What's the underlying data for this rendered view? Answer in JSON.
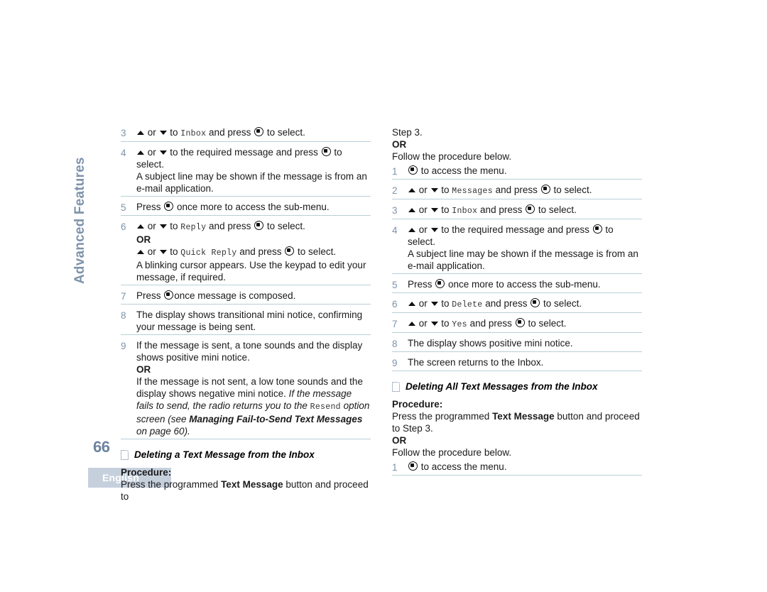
{
  "page": {
    "number": "66",
    "chapter_tab": "Advanced Features",
    "language_tab": "English",
    "accent_color": "#7d93ab",
    "rule_color": "#b9cfd8",
    "tab_bg_color": "#c6d0dd"
  },
  "icons": {
    "up": "up-arrow-icon",
    "down": "down-arrow-icon",
    "menu_button": "menu-select-button-icon",
    "section": "document-page-icon"
  },
  "left_column": {
    "steps": [
      {
        "num": "3",
        "lines": [
          {
            "parts": [
              {
                "t": "icon",
                "v": "up"
              },
              {
                "t": "text",
                "v": " or "
              },
              {
                "t": "icon",
                "v": "down"
              },
              {
                "t": "text",
                "v": " to "
              },
              {
                "t": "mono",
                "v": "Inbox"
              },
              {
                "t": "text",
                "v": " and press "
              },
              {
                "t": "icon",
                "v": "menu"
              },
              {
                "t": "text",
                "v": " to select."
              }
            ]
          }
        ]
      },
      {
        "num": "4",
        "lines": [
          {
            "parts": [
              {
                "t": "icon",
                "v": "up"
              },
              {
                "t": "text",
                "v": " or "
              },
              {
                "t": "icon",
                "v": "down"
              },
              {
                "t": "text",
                "v": " to the required message and press "
              },
              {
                "t": "icon",
                "v": "menu"
              },
              {
                "t": "text",
                "v": " to select."
              }
            ]
          },
          {
            "parts": [
              {
                "t": "text",
                "v": "A subject line may be shown if the message is from an e-mail application."
              }
            ]
          }
        ]
      },
      {
        "num": "5",
        "lines": [
          {
            "parts": [
              {
                "t": "text",
                "v": "Press "
              },
              {
                "t": "icon",
                "v": "menu"
              },
              {
                "t": "text",
                "v": " once more to access the sub-menu."
              }
            ]
          }
        ]
      },
      {
        "num": "6",
        "lines": [
          {
            "parts": [
              {
                "t": "icon",
                "v": "up"
              },
              {
                "t": "text",
                "v": " or "
              },
              {
                "t": "icon",
                "v": "down"
              },
              {
                "t": "text",
                "v": " to "
              },
              {
                "t": "mono",
                "v": "Reply"
              },
              {
                "t": "text",
                "v": " and press "
              },
              {
                "t": "icon",
                "v": "menu"
              },
              {
                "t": "text",
                "v": " to select."
              }
            ]
          },
          {
            "parts": [
              {
                "t": "bold",
                "v": "OR"
              }
            ]
          },
          {
            "parts": [
              {
                "t": "icon",
                "v": "up"
              },
              {
                "t": "text",
                "v": " or "
              },
              {
                "t": "icon",
                "v": "down"
              },
              {
                "t": "text",
                "v": " to "
              },
              {
                "t": "mono",
                "v": "Quick Reply"
              },
              {
                "t": "text",
                "v": " and press "
              },
              {
                "t": "icon",
                "v": "menu"
              },
              {
                "t": "text",
                "v": " to select."
              }
            ]
          },
          {
            "parts": [
              {
                "t": "text",
                "v": "A blinking cursor appears. Use the keypad to edit your message, if required."
              }
            ]
          }
        ]
      },
      {
        "num": "7",
        "lines": [
          {
            "parts": [
              {
                "t": "text",
                "v": "Press "
              },
              {
                "t": "icon",
                "v": "menu"
              },
              {
                "t": "text",
                "v": "once message is composed."
              }
            ]
          }
        ]
      },
      {
        "num": "8",
        "lines": [
          {
            "parts": [
              {
                "t": "text",
                "v": "The display shows transitional mini notice, confirming your message is being sent."
              }
            ]
          }
        ]
      },
      {
        "num": "9",
        "lines": [
          {
            "parts": [
              {
                "t": "text",
                "v": "If the message is sent, a tone sounds and the display shows positive mini notice."
              }
            ]
          },
          {
            "parts": [
              {
                "t": "bold",
                "v": "OR"
              }
            ]
          },
          {
            "parts": [
              {
                "t": "text",
                "v": "If the message is not sent, a low tone sounds and the display shows negative mini notice. "
              },
              {
                "t": "ital",
                "v": "If the message fails to send, the radio returns you to the "
              },
              {
                "t": "mono",
                "v": "Resend"
              },
              {
                "t": "ital",
                "v": " option screen (see "
              },
              {
                "t": "bi",
                "v": "Managing Fail-to-Send Text Messages"
              },
              {
                "t": "ital",
                "v": " on page 60)."
              }
            ]
          }
        ]
      }
    ],
    "section": {
      "title": "Deleting a Text Message from the Inbox",
      "procedure_label": "Procedure:",
      "intro": [
        {
          "parts": [
            {
              "t": "text",
              "v": "Press the programmed "
            },
            {
              "t": "bold",
              "v": "Text Message"
            },
            {
              "t": "text",
              "v": " button and proceed to"
            }
          ]
        }
      ]
    }
  },
  "right_column": {
    "intro": [
      {
        "parts": [
          {
            "t": "text",
            "v": "Step 3."
          }
        ]
      },
      {
        "parts": [
          {
            "t": "bold",
            "v": "OR"
          }
        ]
      },
      {
        "parts": [
          {
            "t": "text",
            "v": "Follow the procedure below."
          }
        ]
      }
    ],
    "steps": [
      {
        "num": "1",
        "lines": [
          {
            "parts": [
              {
                "t": "icon",
                "v": "menu"
              },
              {
                "t": "text",
                "v": " to access the menu."
              }
            ]
          }
        ]
      },
      {
        "num": "2",
        "lines": [
          {
            "parts": [
              {
                "t": "icon",
                "v": "up"
              },
              {
                "t": "text",
                "v": " or "
              },
              {
                "t": "icon",
                "v": "down"
              },
              {
                "t": "text",
                "v": " to "
              },
              {
                "t": "mono",
                "v": "Messages"
              },
              {
                "t": "text",
                "v": " and press "
              },
              {
                "t": "icon",
                "v": "menu"
              },
              {
                "t": "text",
                "v": " to select."
              }
            ]
          }
        ]
      },
      {
        "num": "3",
        "lines": [
          {
            "parts": [
              {
                "t": "icon",
                "v": "up"
              },
              {
                "t": "text",
                "v": " or "
              },
              {
                "t": "icon",
                "v": "down"
              },
              {
                "t": "text",
                "v": " to "
              },
              {
                "t": "mono",
                "v": "Inbox"
              },
              {
                "t": "text",
                "v": " and press "
              },
              {
                "t": "icon",
                "v": "menu"
              },
              {
                "t": "text",
                "v": " to select."
              }
            ]
          }
        ]
      },
      {
        "num": "4",
        "lines": [
          {
            "parts": [
              {
                "t": "icon",
                "v": "up"
              },
              {
                "t": "text",
                "v": " or "
              },
              {
                "t": "icon",
                "v": "down"
              },
              {
                "t": "text",
                "v": " to the required message and press "
              },
              {
                "t": "icon",
                "v": "menu"
              },
              {
                "t": "text",
                "v": " to select."
              }
            ]
          },
          {
            "parts": [
              {
                "t": "text",
                "v": "A subject line may be shown if the message is from an e-mail application."
              }
            ]
          }
        ]
      },
      {
        "num": "5",
        "lines": [
          {
            "parts": [
              {
                "t": "text",
                "v": "Press "
              },
              {
                "t": "icon",
                "v": "menu"
              },
              {
                "t": "text",
                "v": " once more to access the sub-menu."
              }
            ]
          }
        ]
      },
      {
        "num": "6",
        "lines": [
          {
            "parts": [
              {
                "t": "icon",
                "v": "up"
              },
              {
                "t": "text",
                "v": " or "
              },
              {
                "t": "icon",
                "v": "down"
              },
              {
                "t": "text",
                "v": " to "
              },
              {
                "t": "mono",
                "v": "Delete"
              },
              {
                "t": "text",
                "v": " and press "
              },
              {
                "t": "icon",
                "v": "menu"
              },
              {
                "t": "text",
                "v": " to select."
              }
            ]
          }
        ]
      },
      {
        "num": "7",
        "lines": [
          {
            "parts": [
              {
                "t": "icon",
                "v": "up"
              },
              {
                "t": "text",
                "v": " or "
              },
              {
                "t": "icon",
                "v": "down"
              },
              {
                "t": "text",
                "v": " to "
              },
              {
                "t": "mono",
                "v": "Yes"
              },
              {
                "t": "text",
                "v": " and press "
              },
              {
                "t": "icon",
                "v": "menu"
              },
              {
                "t": "text",
                "v": " to select."
              }
            ]
          }
        ]
      },
      {
        "num": "8",
        "lines": [
          {
            "parts": [
              {
                "t": "text",
                "v": "The display shows positive mini notice."
              }
            ]
          }
        ]
      },
      {
        "num": "9",
        "lines": [
          {
            "parts": [
              {
                "t": "text",
                "v": "The screen returns to the Inbox."
              }
            ]
          }
        ]
      }
    ],
    "section": {
      "title": "Deleting All Text Messages from the Inbox",
      "procedure_label": "Procedure:",
      "intro": [
        {
          "parts": [
            {
              "t": "text",
              "v": "Press the programmed "
            },
            {
              "t": "bold",
              "v": "Text Message"
            },
            {
              "t": "text",
              "v": " button and proceed to Step 3."
            }
          ]
        },
        {
          "parts": [
            {
              "t": "bold",
              "v": "OR"
            }
          ]
        },
        {
          "parts": [
            {
              "t": "text",
              "v": "Follow the procedure below."
            }
          ]
        }
      ],
      "steps": [
        {
          "num": "1",
          "lines": [
            {
              "parts": [
                {
                  "t": "icon",
                  "v": "menu"
                },
                {
                  "t": "text",
                  "v": " to access the menu."
                }
              ]
            }
          ]
        }
      ]
    }
  }
}
